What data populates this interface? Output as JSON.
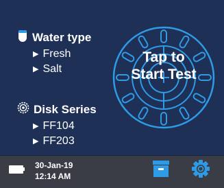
{
  "water_type": {
    "title": "Water type",
    "icon": "water-drop-icon",
    "options": [
      "Fresh",
      "Salt"
    ]
  },
  "disk_series": {
    "title": "Disk Series",
    "icon": "disk-icon",
    "options": [
      "FF104",
      "FF203"
    ]
  },
  "start_button": {
    "line1": "Tap to",
    "line2": "Start Test"
  },
  "status": {
    "date": "30-Jan-19",
    "time": "12:14 AM",
    "battery_icon": "battery-icon",
    "archive_icon": "archive-icon",
    "settings_icon": "gear-icon"
  },
  "colors": {
    "background": "#1f3057",
    "status_bar": "#3a3d46",
    "accent": "#2f9be6",
    "text": "#ffffff"
  }
}
